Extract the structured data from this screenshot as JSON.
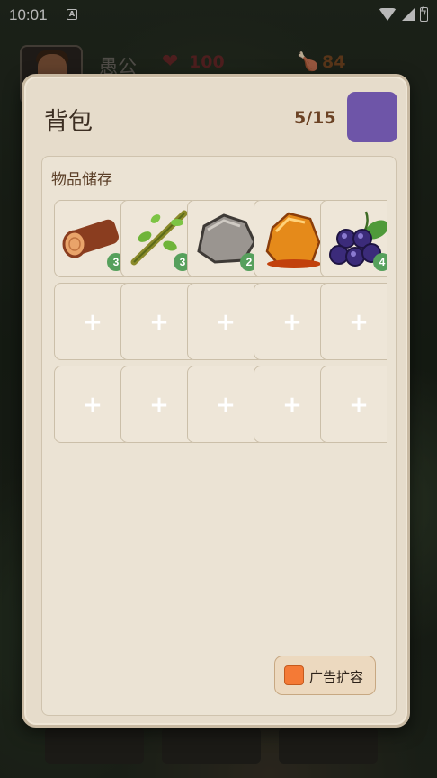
{
  "status_bar": {
    "time": "10:01",
    "notification_icon": "A"
  },
  "hud": {
    "player_name": "愚公",
    "health": "100",
    "food": "84",
    "avatar_icon": "character-portrait"
  },
  "inventory": {
    "title": "背包",
    "capacity": "5/15",
    "section_label": "物品储存",
    "accent_color": "#6e55a8",
    "items": [
      {
        "name": "wood-log",
        "count": "3"
      },
      {
        "name": "vine-branch",
        "count": "3"
      },
      {
        "name": "stone",
        "count": "2"
      },
      {
        "name": "amber-resin",
        "count": ""
      },
      {
        "name": "wild-berries",
        "count": "4"
      }
    ],
    "empty_slot_icon": "+",
    "expand_button_label": "广告扩容"
  }
}
